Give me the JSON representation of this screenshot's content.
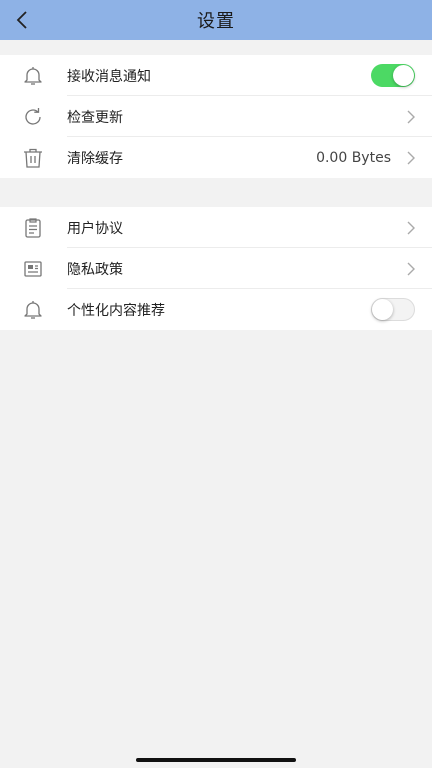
{
  "header": {
    "title": "设置"
  },
  "group1": {
    "items": [
      {
        "label": "接收消息通知",
        "icon": "bell-icon",
        "control": "toggle",
        "toggle_on": true
      },
      {
        "label": "检查更新",
        "icon": "refresh-icon",
        "control": "chevron"
      },
      {
        "label": "清除缓存",
        "icon": "trash-icon",
        "control": "chevron",
        "value": "0.00 Bytes"
      }
    ]
  },
  "group2": {
    "items": [
      {
        "label": "用户协议",
        "icon": "document-icon",
        "control": "chevron"
      },
      {
        "label": "隐私政策",
        "icon": "id-card-icon",
        "control": "chevron"
      },
      {
        "label": "个性化内容推荐",
        "icon": "bell-icon",
        "control": "toggle",
        "toggle_on": false
      }
    ]
  },
  "colors": {
    "header_bg": "#8eb2e6",
    "toggle_on": "#4cd964",
    "page_bg": "#f2f2f2"
  }
}
